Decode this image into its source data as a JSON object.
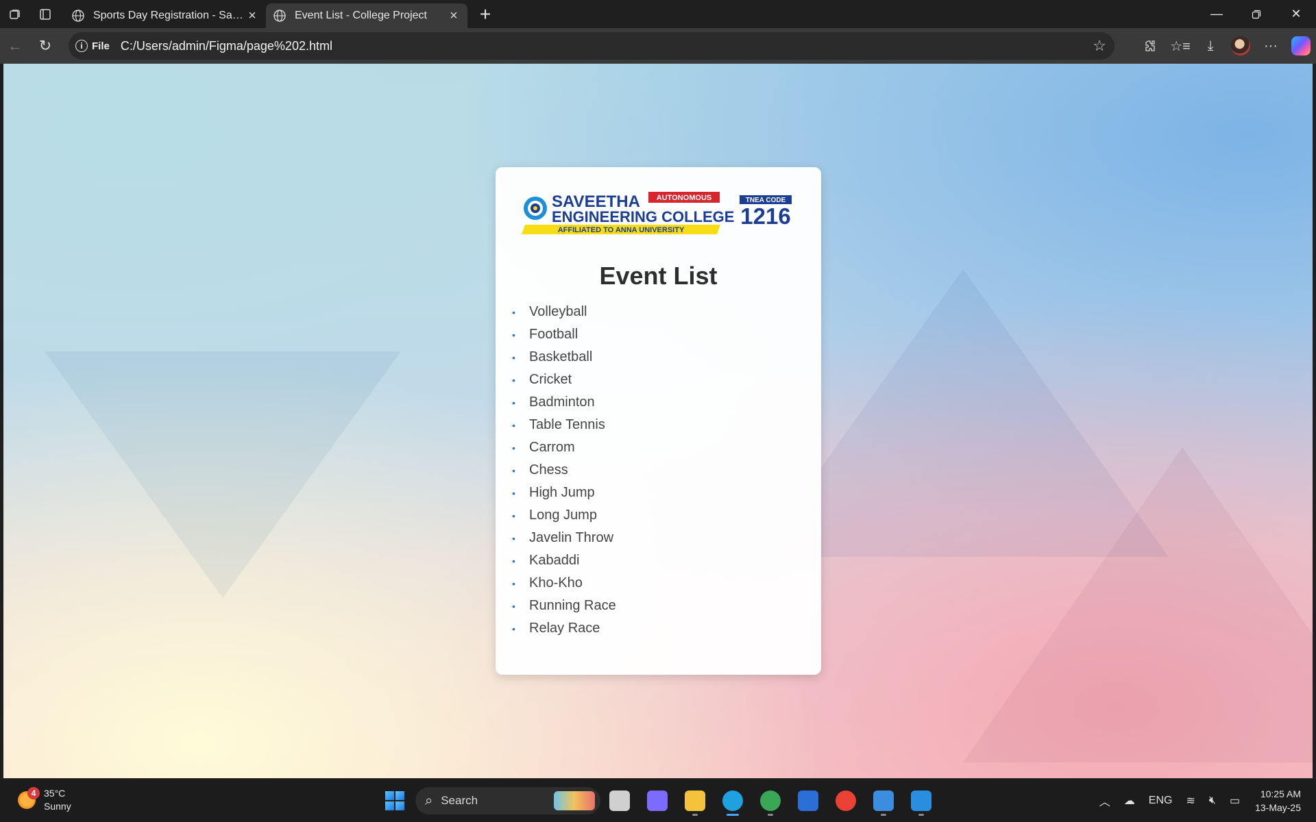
{
  "browser": {
    "tabs": [
      {
        "title": "Sports Day Registration - Saveetha",
        "active": false
      },
      {
        "title": "Event List - College Project",
        "active": true
      }
    ],
    "address": {
      "scheme_label": "File",
      "url": "C:/Users/admin/Figma/page%202.html"
    },
    "icons": {
      "workspaces": "workspaces-icon",
      "tab_actions": "tab-actions-icon",
      "back": "back-arrow-icon",
      "refresh": "refresh-icon",
      "favorite": "star-icon",
      "extensions": "extensions-icon",
      "favorites": "favorites-icon",
      "downloads": "download-icon",
      "more": "more-icon",
      "copilot": "copilot-icon"
    }
  },
  "page": {
    "logo": {
      "college_line1": "SAVEETHA",
      "college_line2": "ENGINEERING COLLEGE",
      "autonomous": "AUTONOMOUS",
      "affiliation": "AFFILIATED TO ANNA UNIVERSITY",
      "tnea_label": "TNEA CODE",
      "tnea_code": "1216"
    },
    "heading": "Event List",
    "events": [
      "Volleyball",
      "Football",
      "Basketball",
      "Cricket",
      "Badminton",
      "Table Tennis",
      "Carrom",
      "Chess",
      "High Jump",
      "Long Jump",
      "Javelin Throw",
      "Kabaddi",
      "Kho-Kho",
      "Running Race",
      "Relay Race"
    ]
  },
  "taskbar": {
    "weather": {
      "badge": "4",
      "temperature": "35°C",
      "condition": "Sunny"
    },
    "search_placeholder": "Search",
    "apps": [
      {
        "name": "task-view",
        "color": "#d0d0d0"
      },
      {
        "name": "copilot",
        "color": "#7b6cff"
      },
      {
        "name": "file-explorer",
        "color": "#f5c23c"
      },
      {
        "name": "edge",
        "color": "#1fa1e0"
      },
      {
        "name": "chrome-dev",
        "color": "#3aa757"
      },
      {
        "name": "microsoft-store",
        "color": "#2b6fd6"
      },
      {
        "name": "chrome",
        "color": "#e94235"
      },
      {
        "name": "photos",
        "color": "#3c8de0"
      },
      {
        "name": "vscode",
        "color": "#2a8ee0"
      }
    ],
    "tray": {
      "language": "ENG",
      "time": "10:25 AM",
      "date": "13-May-25"
    }
  },
  "colors": {
    "accent": "#2f74c0",
    "logo_blue": "#1c3d94",
    "logo_red": "#d7262e",
    "logo_yellow": "#f7dc16"
  }
}
